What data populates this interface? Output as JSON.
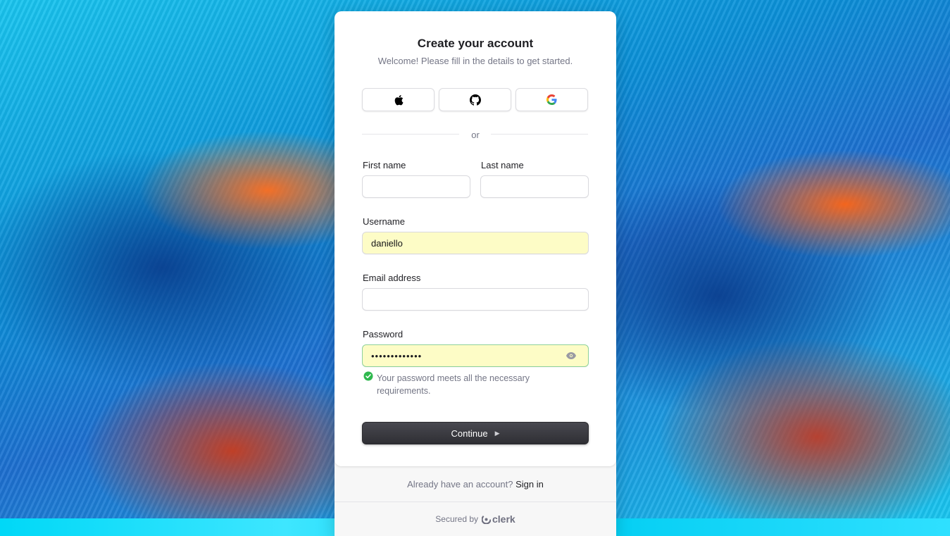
{
  "header": {
    "title": "Create your account",
    "subtitle": "Welcome! Please fill in the details to get started."
  },
  "social": {
    "apple_icon": "apple-icon",
    "github_icon": "github-icon",
    "google_icon": "google-icon"
  },
  "divider": {
    "text": "or"
  },
  "form": {
    "first_name_label": "First name",
    "first_name_value": "",
    "last_name_label": "Last name",
    "last_name_value": "",
    "username_label": "Username",
    "username_value": "daniello",
    "email_label": "Email address",
    "email_value": "",
    "password_label": "Password",
    "password_masked": "•••••••••••••",
    "password_hint": "Your password meets all the necessary requirements.",
    "continue_label": "Continue"
  },
  "footer": {
    "have_account_text": "Already have an account?",
    "sign_in_link": "Sign in",
    "secured_by": "Secured by",
    "brand": "clerk"
  },
  "colors": {
    "primary_button": "#2f2f34",
    "autofill_background": "#fdfcc6",
    "success_green": "#2fb84e"
  }
}
